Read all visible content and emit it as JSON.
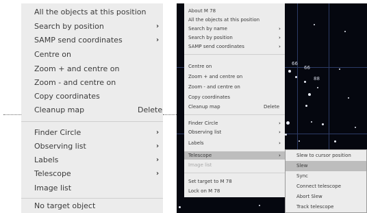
{
  "left_menu": {
    "items": [
      {
        "label": "All the objects at this position",
        "arrow": "",
        "shortcut": ""
      },
      {
        "label": "Search by position",
        "arrow": "›",
        "shortcut": ""
      },
      {
        "label": "SAMP send coordinates",
        "arrow": "›",
        "shortcut": ""
      },
      {
        "label": "Centre on",
        "arrow": "",
        "shortcut": ""
      },
      {
        "label": "Zoom + and centre on",
        "arrow": "",
        "shortcut": ""
      },
      {
        "label": "Zoom - and centre on",
        "arrow": "",
        "shortcut": ""
      },
      {
        "label": "Copy coordinates",
        "arrow": "",
        "shortcut": ""
      },
      {
        "label": "Cleanup map",
        "arrow": "",
        "shortcut": "Delete"
      },
      {
        "label": "Finder Circle",
        "arrow": "›",
        "shortcut": ""
      },
      {
        "label": "Observing list",
        "arrow": "›",
        "shortcut": ""
      },
      {
        "label": "Labels",
        "arrow": "›",
        "shortcut": ""
      },
      {
        "label": "Telescope",
        "arrow": "›",
        "shortcut": ""
      },
      {
        "label": "Image list",
        "arrow": "",
        "shortcut": ""
      },
      {
        "label": "No target object",
        "arrow": "",
        "shortcut": ""
      }
    ]
  },
  "mid_menu": {
    "items": [
      {
        "label": "About M 78",
        "arrow": "",
        "shortcut": ""
      },
      {
        "label": "All the objects at this position",
        "arrow": "",
        "shortcut": ""
      },
      {
        "label": "Search by name",
        "arrow": "›",
        "shortcut": ""
      },
      {
        "label": "Search by position",
        "arrow": "›",
        "shortcut": ""
      },
      {
        "label": "SAMP send coordinates",
        "arrow": "›",
        "shortcut": ""
      },
      {
        "label": "Centre on",
        "arrow": "",
        "shortcut": ""
      },
      {
        "label": "Zoom + and centre on",
        "arrow": "",
        "shortcut": ""
      },
      {
        "label": "Zoom - and centre on",
        "arrow": "",
        "shortcut": ""
      },
      {
        "label": "Copy coordinates",
        "arrow": "",
        "shortcut": ""
      },
      {
        "label": "Cleanup map",
        "arrow": "",
        "shortcut": "Delete"
      },
      {
        "label": "Finder Circle",
        "arrow": "›",
        "shortcut": ""
      },
      {
        "label": "Observing list",
        "arrow": "›",
        "shortcut": ""
      },
      {
        "label": "Labels",
        "arrow": "›",
        "shortcut": ""
      },
      {
        "label": "Telescope",
        "arrow": "›",
        "shortcut": ""
      },
      {
        "label": "Image list",
        "arrow": "",
        "shortcut": ""
      },
      {
        "label": "Set target to M 78",
        "arrow": "",
        "shortcut": ""
      },
      {
        "label": "Lock on M 78",
        "arrow": "",
        "shortcut": ""
      }
    ]
  },
  "telescope_submenu": {
    "items": [
      {
        "label": "Slew to cursor position"
      },
      {
        "label": "Slew"
      },
      {
        "label": "Sync"
      },
      {
        "label": "Connect telescope"
      },
      {
        "label": "Abort Slew"
      },
      {
        "label": "Track telescope"
      }
    ]
  },
  "sky": {
    "labels": [
      "66",
      "66",
      "88"
    ]
  }
}
